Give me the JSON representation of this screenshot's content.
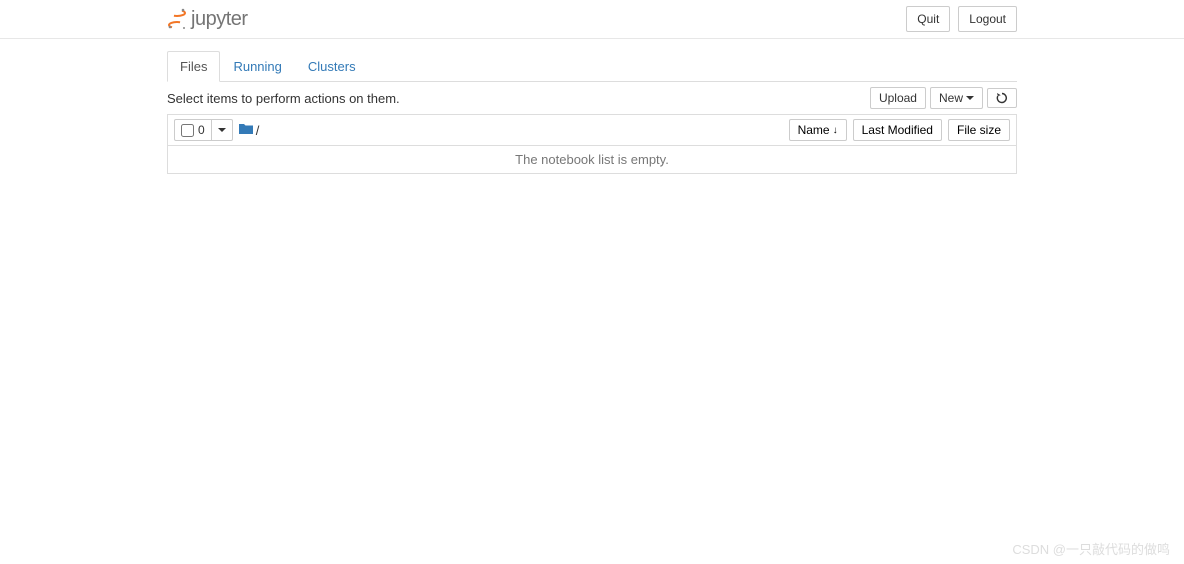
{
  "header": {
    "logo_text": "jupyter",
    "quit_label": "Quit",
    "logout_label": "Logout"
  },
  "tabs": {
    "files": "Files",
    "running": "Running",
    "clusters": "Clusters"
  },
  "toolbar": {
    "hint": "Select items to perform actions on them.",
    "upload_label": "Upload",
    "new_label": "New"
  },
  "list": {
    "selected_count": "0",
    "breadcrumb_sep": "/",
    "name_label": "Name",
    "last_modified_label": "Last Modified",
    "file_size_label": "File size",
    "empty_message": "The notebook list is empty."
  },
  "watermark": "CSDN @一只敲代码的做鸣"
}
